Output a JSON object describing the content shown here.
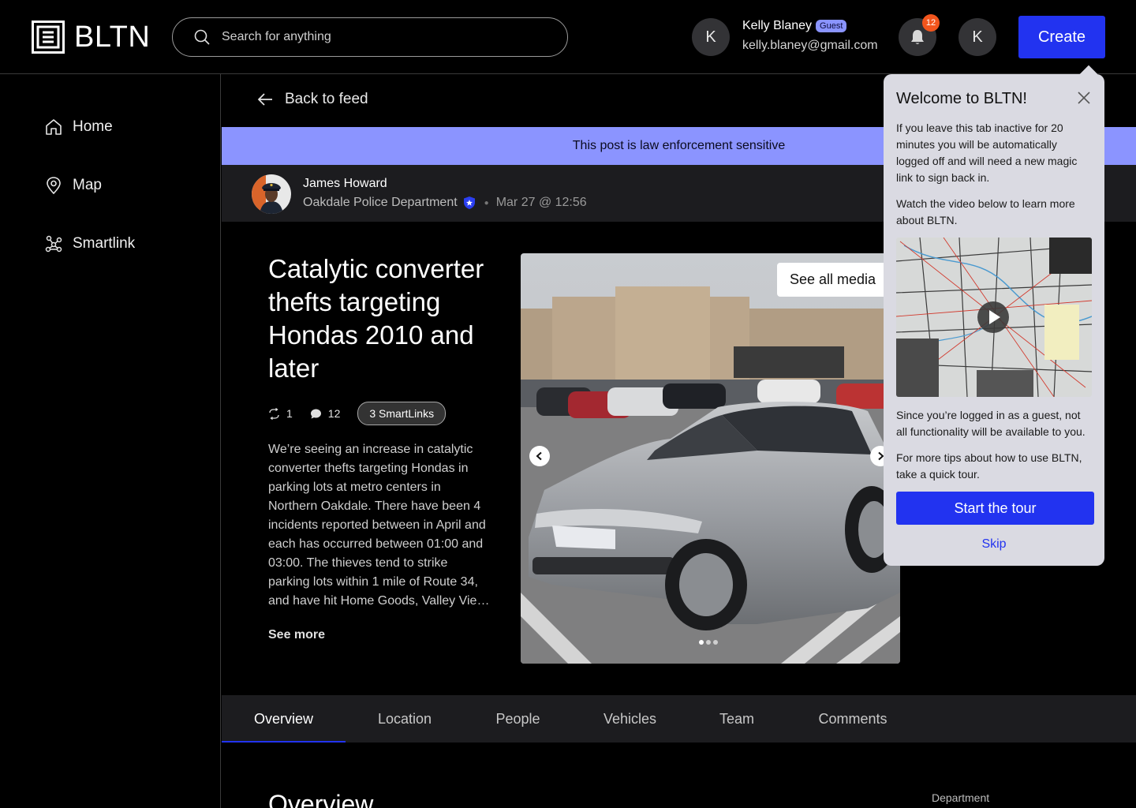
{
  "header": {
    "logo_text": "BLTN",
    "search_placeholder": "Search for anything",
    "user_initial": "K",
    "user_name": "Kelly Blaney",
    "user_badge": "Guest",
    "user_email": "kelly.blaney@gmail.com",
    "notification_count": "12",
    "profile_initial": "K",
    "create_label": "Create"
  },
  "sidebar": {
    "items": [
      {
        "label": "Home",
        "icon": "home-icon"
      },
      {
        "label": "Map",
        "icon": "map-pin-icon"
      },
      {
        "label": "Smartlink",
        "icon": "network-icon"
      }
    ]
  },
  "post": {
    "back_label": "Back to feed",
    "sensitivity_banner": "This post is law enforcement sensitive",
    "author_name": "James Howard",
    "department": "Oakdale Police Department",
    "date": "Mar 27 @ 12:56",
    "title": "Catalytic converter thefts targeting Hondas 2010 and later",
    "reposts": "1",
    "comments": "12",
    "smartlinks_label": "3 SmartLinks",
    "description": "We’re seeing an increase in catalytic converter thefts targeting Hondas in parking lots at metro centers in Northern Oakdale. There have been 4 incidents reported between in April and each has occurred between 01:00 and 03:00. The thieves tend to strike parking lots within 1 mile of Route 34, and have hit Home Goods, Valley Vie…",
    "see_more_label": "See more",
    "see_all_media_label": "See all media",
    "media_count": 3,
    "media_active_index": 0
  },
  "tabs": [
    {
      "label": "Overview",
      "active": true
    },
    {
      "label": "Location",
      "active": false
    },
    {
      "label": "People",
      "active": false
    },
    {
      "label": "Vehicles",
      "active": false
    },
    {
      "label": "Team",
      "active": false
    },
    {
      "label": "Comments",
      "active": false
    }
  ],
  "section": {
    "overview_heading": "Overview",
    "department_label": "Department"
  },
  "welcome_popover": {
    "title": "Welcome to BLTN!",
    "paragraph_1": "If you leave this tab inactive for 20 minutes you will be automatically logged off and will need a new magic link to sign back in.",
    "paragraph_2": "Watch the video below to learn more about BLTN.",
    "paragraph_3": "Since you’re logged in as a guest, not all functionality will be available to you.",
    "paragraph_4": "For more tips about how to use BLTN, take a quick tour.",
    "start_tour_label": "Start the tour",
    "skip_label": "Skip"
  },
  "colors": {
    "accent": "#2233f0",
    "banner": "#8b94ff",
    "notification": "#f2551d",
    "popover_bg": "#dadae2"
  }
}
